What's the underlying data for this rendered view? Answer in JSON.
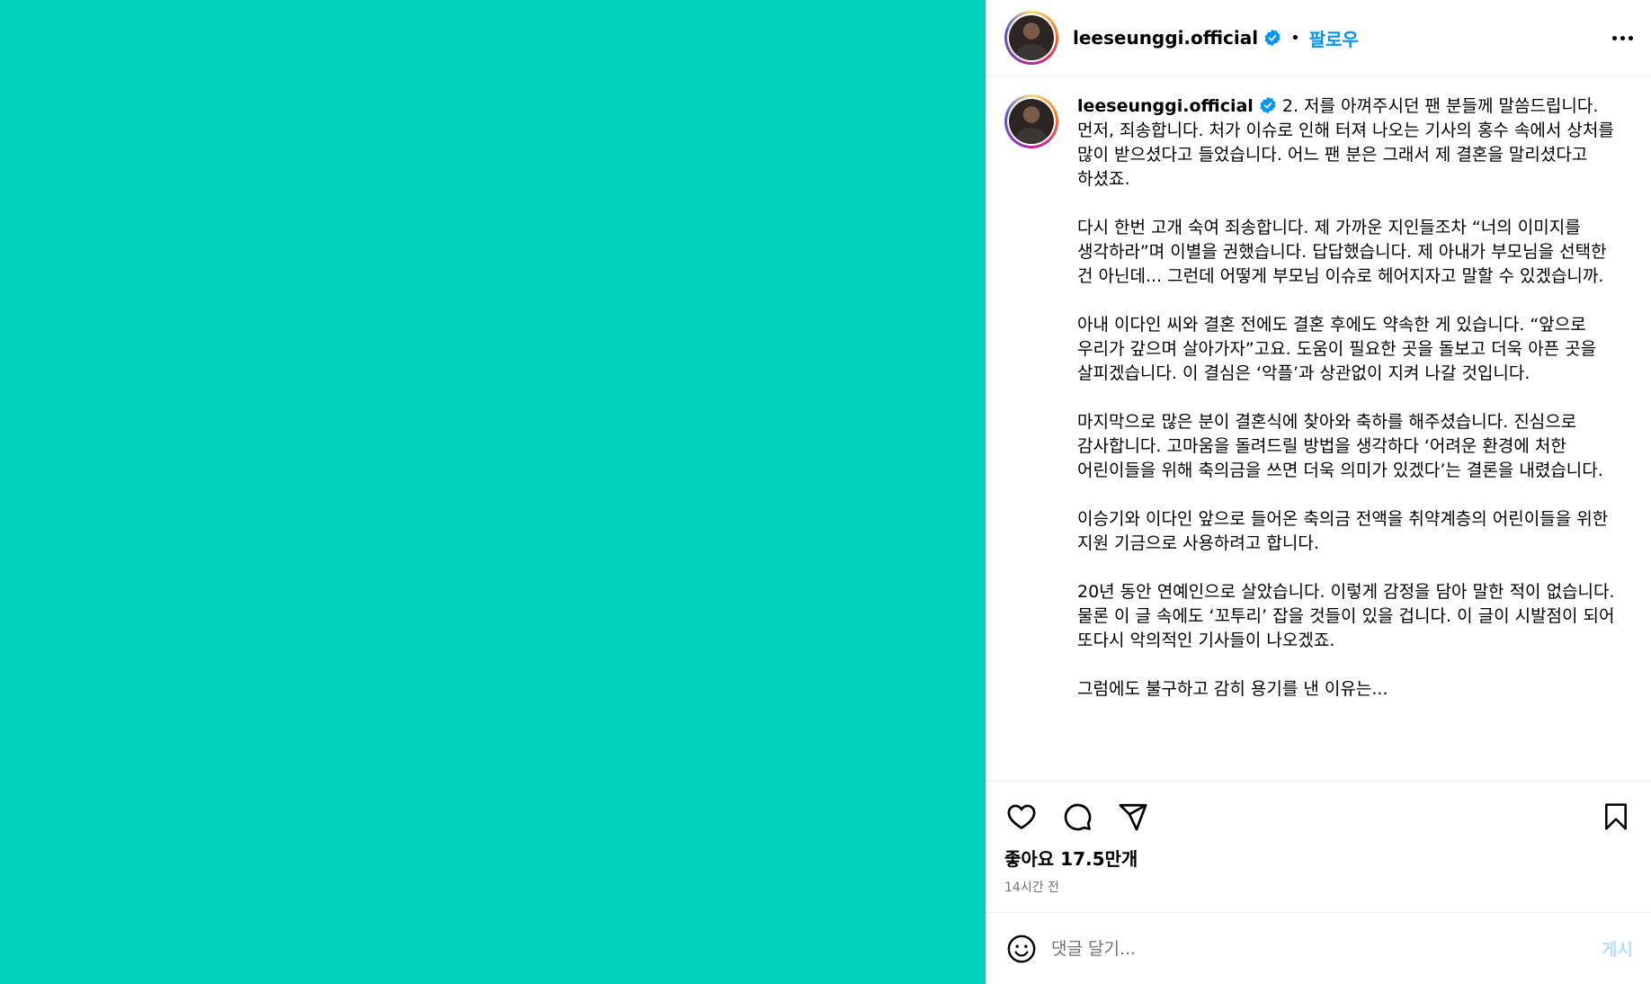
{
  "colors": {
    "media_background": "#00D1BB",
    "follow_link": "#0095f6",
    "post_disabled": "#b2dffc",
    "verified_badge": "#0095f6"
  },
  "header": {
    "username": "leeseunggi.official",
    "separator": "•",
    "follow_label": "팔로우",
    "more_icon": "more-horizontal-icon"
  },
  "caption": {
    "username": "leeseunggi.official",
    "paragraphs": [
      "2. 저를 아껴주시던 팬 분들께 말씀드립니다. 먼저, 죄송합니다. 처가 이슈로 인해 터져 나오는 기사의 홍수 속에서 상처를 많이 받으셨다고 들었습니다. 어느 팬 분은 그래서 제 결혼을 말리셨다고 하셨죠.",
      "다시 한번 고개 숙여 죄송합니다. 제 가까운 지인들조차 “너의 이미지를 생각하라”며 이별을 권했습니다. 답답했습니다. 제 아내가 부모님을 선택한 건 아닌데... 그런데 어떻게 부모님 이슈로 헤어지자고 말할 수 있겠습니까.",
      "아내 이다인 씨와 결혼 전에도 결혼 후에도 약속한 게 있습니다. “앞으로 우리가 갚으며 살아가자”고요. 도움이 필요한 곳을 돌보고 더욱 아픈 곳을 살피겠습니다. 이 결심은 ‘악플’과 상관없이 지켜 나갈 것입니다.",
      "마지막으로 많은 분이 결혼식에 찾아와 축하를 해주셨습니다. 진심으로 감사합니다. 고마움을 돌려드릴 방법을 생각하다 ‘어려운 환경에 처한 어린이들을 위해 축의금을 쓰면 더욱 의미가 있겠다’는 결론을 내렸습니다.",
      "이승기와 이다인 앞으로 들어온 축의금 전액을 취약계층의 어린이들을 위한 지원 기금으로 사용하려고 합니다.",
      "20년 동안 연예인으로 살았습니다. 이렇게 감정을 담아 말한 적이 없습니다. 물론 이 글 속에도 ‘꼬투리’ 잡을 것들이 있을 겁니다. 이 글이 시발점이 되어 또다시 악의적인 기사들이 나오겠죠.",
      "그럼에도 불구하고 감히 용기를 낸 이유는..."
    ]
  },
  "actions": {
    "like_icon": "heart-icon",
    "comment_icon": "comment-icon",
    "share_icon": "share-icon",
    "save_icon": "bookmark-icon"
  },
  "likes": {
    "text": "좋아요 17.5만개"
  },
  "timestamp": "14시간 전",
  "comment": {
    "emoji_icon": "emoji-icon",
    "placeholder": "댓글 달기...",
    "post_label": "게시"
  }
}
